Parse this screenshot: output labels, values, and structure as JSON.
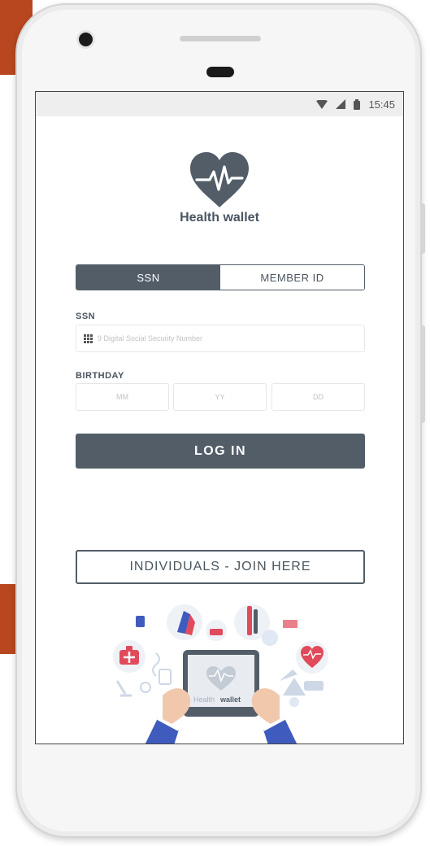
{
  "status_bar": {
    "time": "15:45",
    "icons": [
      "wifi-icon",
      "signal-icon",
      "battery-icon"
    ]
  },
  "app": {
    "name": "Health wallet",
    "logo_icon": "heart-pulse-icon"
  },
  "tabs": [
    {
      "label": "SSN",
      "active": true
    },
    {
      "label": "MEMBER ID",
      "active": false
    }
  ],
  "form": {
    "ssn_label": "SSN",
    "ssn_placeholder": "9 Digital Social Security Number",
    "ssn_icon": "keypad-icon",
    "birthday_label": "BIRTHDAY",
    "birthday_fields": [
      "MM",
      "YY",
      "DD"
    ]
  },
  "login_label": "LOG IN",
  "join_label": "INDIVIDUALS - JOIN HERE",
  "illustration": {
    "tablet_brand_light": "Health",
    "tablet_brand_bold": "wallet"
  },
  "colors": {
    "primary": "#525d68",
    "accent_red": "#e14a5a",
    "accent_blue": "#3e5bbd",
    "background_accent": "#b8471f"
  }
}
